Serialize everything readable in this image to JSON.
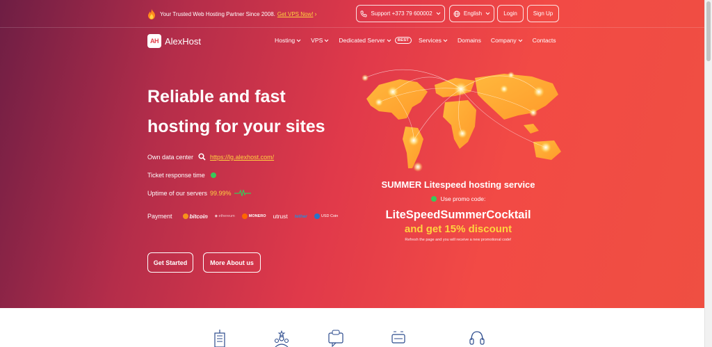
{
  "topbar": {
    "trust_text": "Your Trusted Web Hosting Partner Since 2008.",
    "trust_link": "Get VPS Now!",
    "support_label": "Support +373 79 600002",
    "language_label": "English",
    "login_label": "Login",
    "signup_label": "Sign Up"
  },
  "brand": {
    "logo_mark": "AH",
    "name": "AlexHost"
  },
  "nav": {
    "items": [
      {
        "label": "Hosting"
      },
      {
        "label": "VPS"
      },
      {
        "label": "Dedicated Server"
      },
      {
        "label": "Services"
      },
      {
        "label": "Domains"
      },
      {
        "label": "Company"
      },
      {
        "label": "Contacts"
      }
    ],
    "best_badge": "BEST"
  },
  "hero": {
    "headline_line1": "Reliable and fast",
    "headline_line2": "hosting for your sites",
    "data_center_label": "Own data center",
    "data_center_link": "https://lg.alexhost.com/",
    "ticket_label": "Ticket response time",
    "uptime_label": "Uptime of our servers",
    "uptime_value": "99.99%",
    "payment_label": "Payment",
    "payment_methods": [
      "bitcoin",
      "ethereum",
      "MONERO",
      "utrust",
      "tether",
      "USD Coin"
    ],
    "get_started_label": "Get Started",
    "more_about_label": "More About us"
  },
  "promo": {
    "title": "SUMMER Litespeed hosting service",
    "use_label": "Use promo code:",
    "code": "LiteSpeedSummerCocktail",
    "discount": "and get 15% discount",
    "note": "Refresh the page and you will receive a new promotional code!"
  },
  "colors": {
    "accent_yellow": "#ffd23f",
    "status_green": "#38c95a",
    "hero_red": "#ef4f42",
    "hero_purple": "#6e1e44"
  },
  "feature_icons": [
    "building-icon",
    "team-stars-icon",
    "live-chat-icon",
    "server-speed-icon",
    "headset-icon"
  ]
}
